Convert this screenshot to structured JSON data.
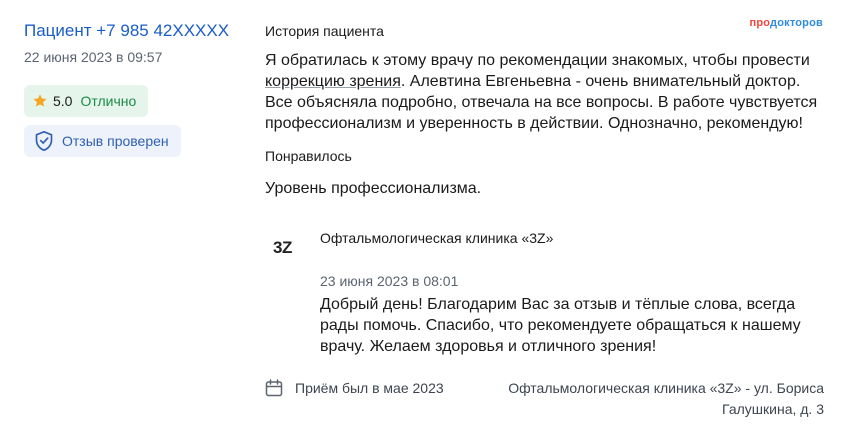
{
  "reviewer": {
    "name": "Пациент +7 985 42XXXXX",
    "date": "22 июня 2023 в 09:57"
  },
  "rating": {
    "score": "5.0",
    "label": "Отлично",
    "icon": "star-icon",
    "color": "#f5a623"
  },
  "verification": {
    "label": "Отзыв проверен",
    "icon": "shield-check-icon"
  },
  "brand": {
    "prefix": "про",
    "suffix": "докторов"
  },
  "story": {
    "title": "История пациента",
    "text_before": "Я обратилась к этому врачу по рекомендации знакомых, чтобы провести ",
    "link_text": "коррекцию зрения",
    "text_after": ". Алевтина Евгеньевна - очень внимательный доктор. Все объясняла подробно, отвечала на все вопросы. В работе чувствуется профессионализм и уверенность в действии. Однозначно, рекомендую!"
  },
  "liked": {
    "title": "Понравилось",
    "text": "Уровень профессионализма."
  },
  "reply": {
    "logo": "3Z",
    "clinic_name": "Офтальмологическая клиника «3Z»",
    "date": "23 июня 2023 в 08:01",
    "text": "Добрый день! Благодарим Вас за отзыв и тёплые слова, всегда рады помочь. Спасибо, что рекомендуете обращаться к нашему врачу. Желаем здоровья и отличного зрения!"
  },
  "footer": {
    "visit": "Приём был в мае 2023",
    "visit_icon": "calendar-icon",
    "location": "Офтальмологическая клиника «3Z» - ул. Бориса Галушкина, д. 3"
  }
}
